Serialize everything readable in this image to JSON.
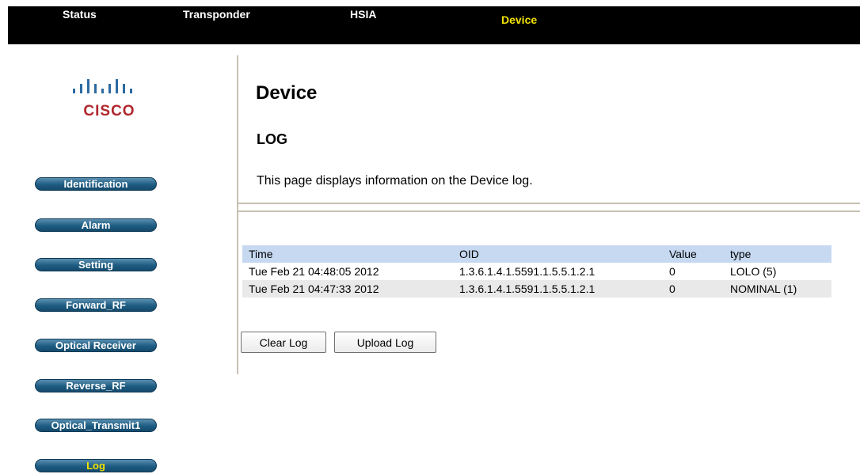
{
  "nav": {
    "tabs": [
      {
        "label": "Status"
      },
      {
        "label": "Transponder"
      },
      {
        "label": "HSIA"
      },
      {
        "label": "Device"
      }
    ],
    "active": "Device"
  },
  "logo": {
    "wordmark": "CISCO",
    "icon": "cisco-bars-logo"
  },
  "sidebar": {
    "items": [
      {
        "label": "Identification"
      },
      {
        "label": "Alarm"
      },
      {
        "label": "Setting"
      },
      {
        "label": "Forward_RF"
      },
      {
        "label": "Optical Receiver"
      },
      {
        "label": "Reverse_RF"
      },
      {
        "label": "Optical_Transmit1"
      },
      {
        "label": "Log"
      }
    ],
    "active": "Log"
  },
  "main": {
    "title": "Device",
    "section": "LOG",
    "description": "This page displays information on the Device log."
  },
  "table": {
    "headers": [
      "Time",
      "OID",
      "Value",
      "type"
    ],
    "rows": [
      [
        "Tue Feb 21 04:48:05 2012",
        "1.3.6.1.4.1.5591.1.5.5.1.2.1",
        "0",
        "LOLO (5)"
      ],
      [
        "Tue Feb 21 04:47:33 2012",
        "1.3.6.1.4.1.5591.1.5.5.1.2.1",
        "0",
        "NOMINAL (1)"
      ]
    ]
  },
  "buttons": {
    "clear": "Clear Log",
    "upload": "Upload Log"
  },
  "colors": {
    "nav_background": "#000000",
    "nav_active": "#f2e200",
    "sidebar_button": "#1e5c82",
    "brand_red": "#b0272c",
    "table_header": "#c6d9f1",
    "table_alt_row": "#e9e9e9"
  }
}
